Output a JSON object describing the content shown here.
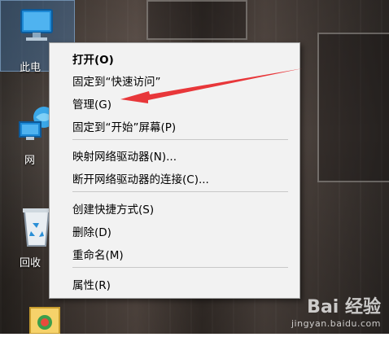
{
  "desktop": {
    "icons": [
      {
        "label": "此电",
        "icon": "computer-icon"
      },
      {
        "label": "网",
        "icon": "network-icon"
      },
      {
        "label": "回收",
        "icon": "recycle-bin-icon"
      },
      {
        "label": "",
        "icon": "control-panel-icon"
      }
    ]
  },
  "context_menu": {
    "items": [
      {
        "label": "打开(O)",
        "bold": true
      },
      {
        "label": "固定到“快速访问”"
      },
      {
        "label": "管理(G)"
      },
      {
        "label": "固定到“开始”屏幕(P)"
      },
      {
        "label": "映射网络驱动器(N)..."
      },
      {
        "label": "断开网络驱动器的连接(C)..."
      },
      {
        "label": "创建快捷方式(S)"
      },
      {
        "label": "删除(D)"
      },
      {
        "label": "重命名(M)"
      },
      {
        "label": "属性(R)"
      }
    ]
  },
  "annotation": {
    "arrow_color": "#e8373a",
    "points_to": "管理(G)"
  },
  "watermark": {
    "main": "Bai 经验",
    "sub": "jingyan.baidu.com"
  }
}
